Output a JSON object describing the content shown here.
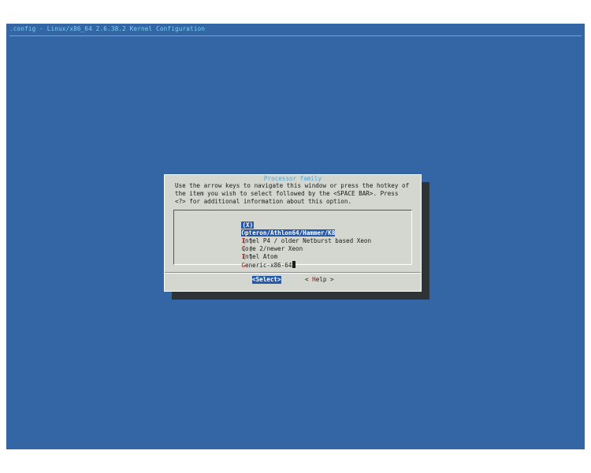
{
  "window": {
    "title": ".config - Linux/x86_64 2.6.38.2 Kernel Configuration"
  },
  "dialog": {
    "title": "Processor family",
    "instructions": "Use the arrow keys to navigate this window or press the hotkey of\nthe item you wish to select followed by the <SPACE BAR>. Press\n<?> for additional information about this option."
  },
  "options": [
    {
      "mark": "(X)",
      "hotkey": "O",
      "rest": "pteron/Athlon64/Hammer/K8",
      "selected": true
    },
    {
      "mark": "( )",
      "hotkey": "I",
      "rest": "ntel P4 / older Netburst based Xeon",
      "selected": false
    },
    {
      "mark": "( )",
      "hotkey": "C",
      "rest": "ore 2/newer Xeon",
      "selected": false
    },
    {
      "mark": "( )",
      "hotkey": "I",
      "rest": "ntel Atom",
      "selected": false
    },
    {
      "mark": "( )",
      "hotkey": "G",
      "rest": "eneric-x86-64",
      "selected": false
    }
  ],
  "buttons": {
    "select": "<Select>",
    "help_prefix": "< ",
    "help_hotkey": "H",
    "help_rest": "elp >"
  },
  "colors": {
    "background": "#3465a4",
    "dialog": "#d3d7cf",
    "highlight": "#2859a8",
    "hotkey": "#cc0000",
    "title": "#7ad6f6"
  }
}
